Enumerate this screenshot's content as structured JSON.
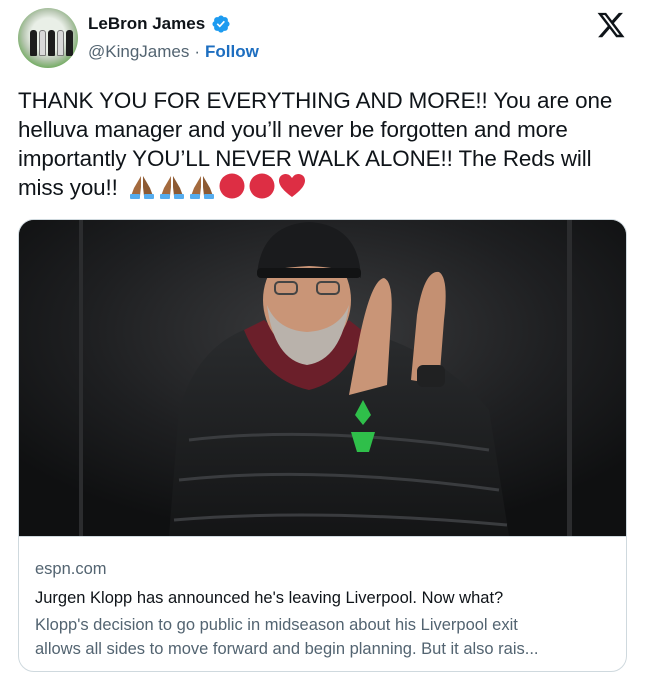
{
  "author": {
    "display_name": "LeBron James",
    "handle": "@KingJames",
    "separator": "·",
    "follow_label": "Follow",
    "verified": true
  },
  "tweet": {
    "text": "THANK YOU FOR EVERYTHING AND MORE!! You are one helluva manager and you’ll never be forgotten and more importantly YOU’LL NEVER WALK ALONE!! The Reds will miss you!!",
    "emojis": [
      "folded-hands-medium-dark-skin",
      "folded-hands-medium-dark-skin",
      "folded-hands-medium-dark-skin",
      "red-circle",
      "red-circle",
      "red-heart"
    ]
  },
  "link_card": {
    "domain": "espn.com",
    "title": "Jurgen Klopp has announced he's leaving Liverpool. Now what?",
    "description_line1": "Klopp's decision to go public in midseason about his Liverpool exit",
    "description_line2": "allows all sides to move forward and begin planning. But it also rais..."
  },
  "colors": {
    "text": "#0f1419",
    "secondary": "#536471",
    "link": "#1d6ec0",
    "verified": "#1d9bf0",
    "border": "#cfd9de",
    "emoji_red": "#dd2e44",
    "emoji_skin": "#a46a3e"
  }
}
